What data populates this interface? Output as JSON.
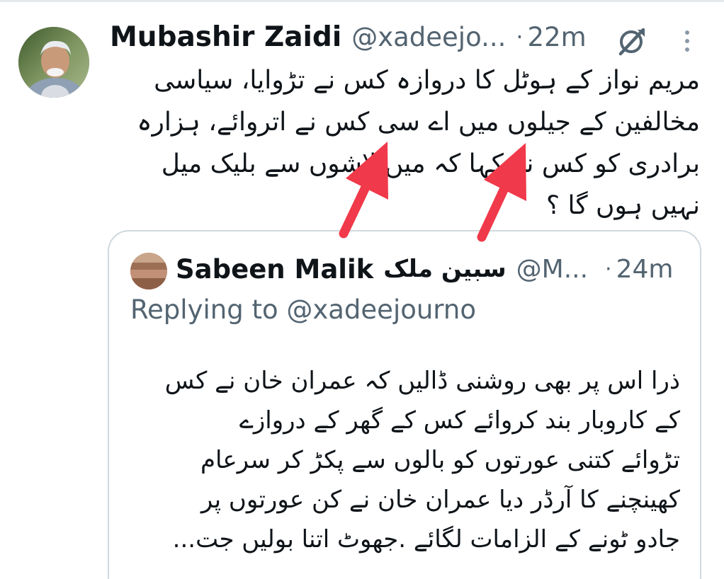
{
  "tweet": {
    "author_name": "Mubashir Zaidi",
    "author_handle": "@xadeejo...",
    "separator": "·",
    "time": "22m",
    "avatar_icon": "profile-photo",
    "grok_icon": "grok-icon",
    "more_icon": "more-vertical-icon",
    "text": "مریم نواز کے ہوٹل کا دروازہ کس نے تڑوایا، سیاسی\nمخالفین کے جیلوں میں اے سی کس نے اتروائے، ہزارہ\nبرادری کو کس نے کہا کہ میں لاشوں سے بلیک میل\nنہیں ہوں گا ؟"
  },
  "quoted_tweet": {
    "author_name": "Sabeen Malik",
    "author_name_urdu": "سبین ملک",
    "author_handle": "@M...",
    "separator": "·",
    "time": "24m",
    "replying_to": "Replying to @xadeejourno",
    "text": "ذرا اس پر بھی روشنی ڈالیں کہ عمران خان نے کس\nکے کاروبار بند کروائے کس کے گھر کے دروازے\nتڑوائے کتنی عورتوں کو بالوں سے پکڑ کر سرعام\nکھینچنے کا آرڈر دیا عمران خان نے کن عورتوں پر\nجادو ٹونے کے الزامات لگائے .جھوٹ اتنا بولیں جت..."
  },
  "annotations": {
    "arrow_color": "#f0394a",
    "count": 2
  },
  "colors": {
    "primary_text": "#0f1419",
    "secondary_text": "#536471",
    "card_border": "#cfd9de"
  }
}
